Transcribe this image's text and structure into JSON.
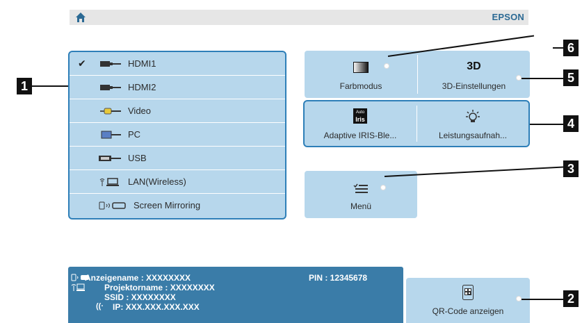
{
  "topbar": {
    "brand": "EPSON",
    "home_icon": "home-icon"
  },
  "sources": [
    {
      "label": "HDMI1",
      "icon": "hdmi-connector-icon",
      "selected": true
    },
    {
      "label": "HDMI2",
      "icon": "hdmi-connector-icon",
      "selected": false
    },
    {
      "label": "Video",
      "icon": "video-connector-icon",
      "selected": false
    },
    {
      "label": "PC",
      "icon": "pc-connector-icon",
      "selected": false
    },
    {
      "label": "USB",
      "icon": "usb-connector-icon",
      "selected": false
    },
    {
      "label": "LAN(Wireless)",
      "icon": "lan-wireless-icon",
      "selected": false
    },
    {
      "label": "Screen Mirroring",
      "icon": "screen-mirroring-icon",
      "selected": false
    }
  ],
  "tiles": {
    "color_mode": {
      "label": "Farbmodus",
      "icon": "color-mode-icon"
    },
    "three_d": {
      "label": "3D-Einstellungen",
      "icon": "3d-icon",
      "icon_text": "3D"
    },
    "adaptive_iris": {
      "label": "Adaptive IRIS-Ble...",
      "icon": "auto-iris-icon",
      "icon_text_top": "Auto",
      "icon_text_bottom": "Iris"
    },
    "power": {
      "label": "Leistungsaufnah...",
      "icon": "lamp-power-icon"
    },
    "menu": {
      "label": "Menü",
      "icon": "menu-list-icon"
    },
    "qr": {
      "label": "QR-Code anzeigen",
      "icon": "qr-code-icon"
    }
  },
  "info": {
    "display_name": "Anzeigename : XXXXXXXX",
    "projector_name": "Projektorname : XXXXXXXX",
    "ssid": "SSID : XXXXXXXX",
    "ip": "IP: XXX.XXX.XXX.XXX",
    "pin": "PIN : 12345678"
  },
  "callouts": [
    "1",
    "2",
    "3",
    "4",
    "5",
    "6"
  ],
  "colors": {
    "tile_bg": "#b7d7ec",
    "border": "#2e7fb8",
    "info_bg": "#3a7ca8",
    "brand": "#2c6a94"
  }
}
